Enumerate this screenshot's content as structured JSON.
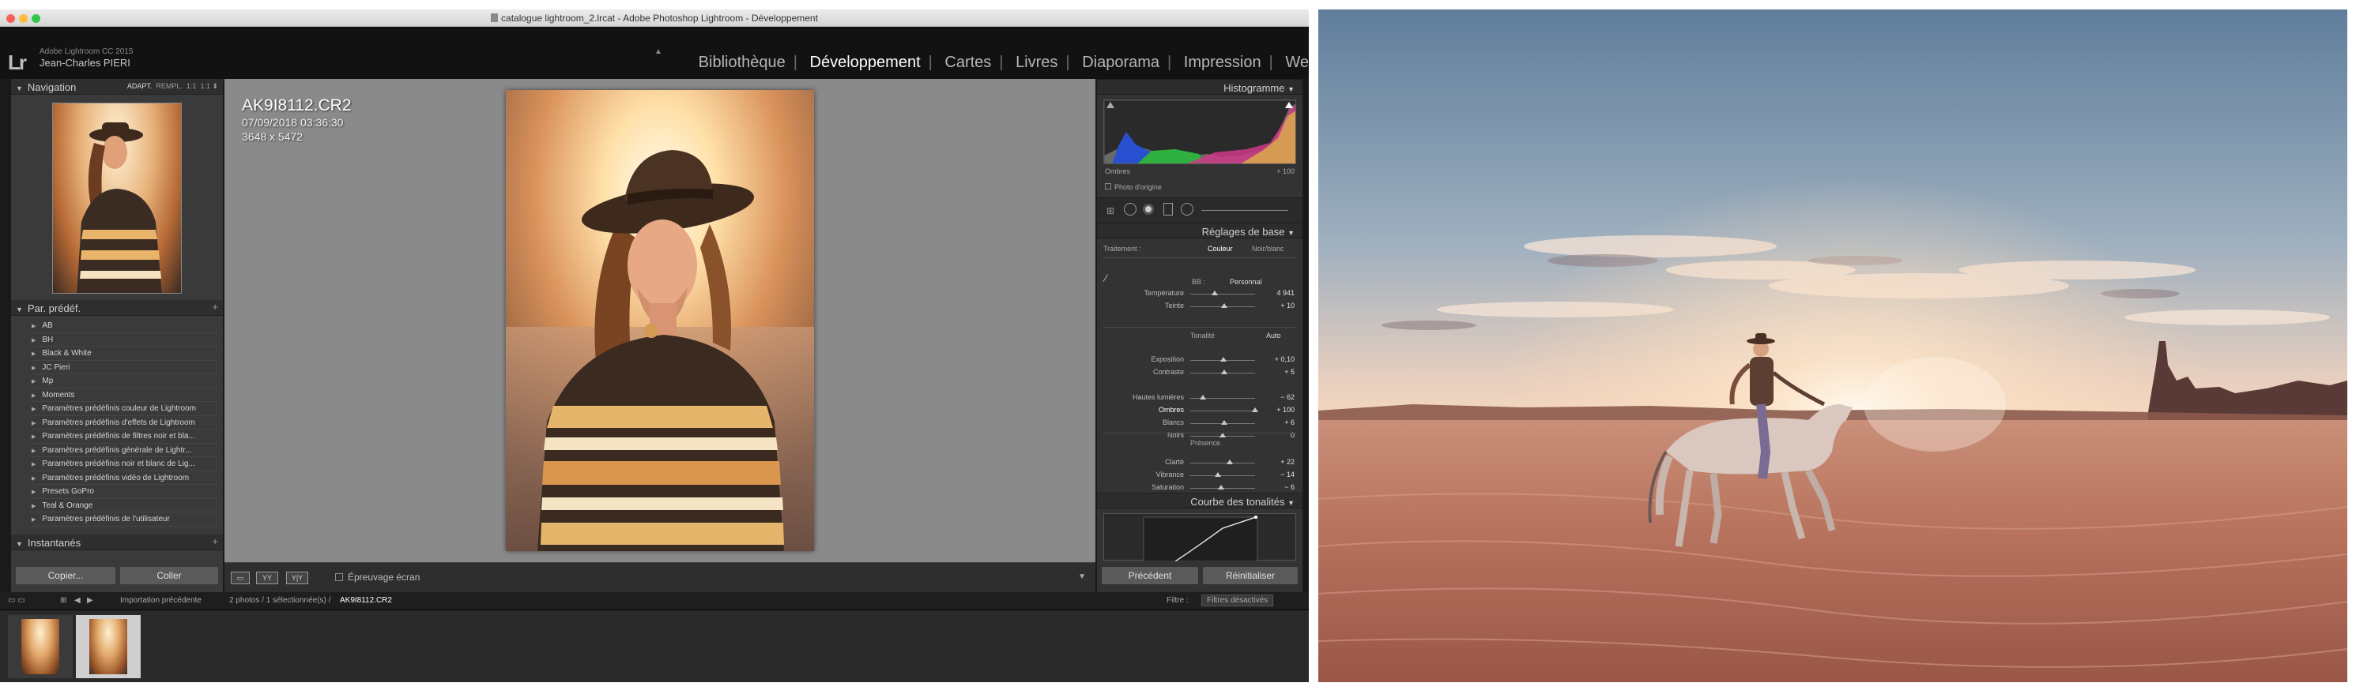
{
  "window": {
    "title": "catalogue lightroom_2.lrcat - Adobe Photoshop Lightroom - Développement"
  },
  "identity": {
    "line1": "Adobe Lightroom CC 2015",
    "line2": "Jean-Charles PIERI",
    "logo": "Lr"
  },
  "modules": [
    "Bibliothèque",
    "Développement",
    "Cartes",
    "Livres",
    "Diaporama",
    "Impression",
    "We"
  ],
  "active_module": "Développement",
  "navigator": {
    "title": "Navigation",
    "zoom_options": [
      "ADAPT.",
      "REMPL.",
      "1:1",
      "1:1"
    ]
  },
  "presets": {
    "title": "Par. prédéf.",
    "items": [
      "AB",
      "BH",
      "Black & White",
      "JC Pieri",
      "Mp",
      "Moments",
      "Paramètres prédéfinis couleur de Lightroom",
      "Paramètres prédéfinis d'effets de Lightroom",
      "Paramètres prédéfinis de filtres noir et bla...",
      "Paramètres prédéfinis générale de Lightr...",
      "Paramètres prédéfinis noir et blanc de Lig...",
      "Paramètres prédéfinis vidéo de Lightroom",
      "Presets GoPro",
      "Teal & Orange",
      "Paramètres prédéfinis de l'utilisateur"
    ]
  },
  "snapshots": {
    "title": "Instantanés"
  },
  "left_buttons": {
    "copy": "Copier...",
    "paste": "Coller"
  },
  "photo_info": {
    "filename": "AK9I8112.CR2",
    "datetime": "07/09/2018 03:36:30",
    "dimensions": "3648 x 5472"
  },
  "toolbar": {
    "soft_proof": "Épreuvage écran"
  },
  "histogram": {
    "title": "Histogramme",
    "shadow_label": "Ombres",
    "shadow_value": "+ 100",
    "original_photo": "Photo d'origine"
  },
  "basic": {
    "title": "Réglages de base",
    "treatment_label": "Traitement :",
    "treatment_color": "Couleur",
    "treatment_bw": "Noir/blanc",
    "wb_label": "BB :",
    "wb_value": "Personnal",
    "tone_label": "Tonalité",
    "tone_auto": "Auto",
    "presence_label": "Présence",
    "sliders": [
      {
        "label": "Température",
        "value": "4 941",
        "pos": 0.38
      },
      {
        "label": "Teinte",
        "value": "+ 10",
        "pos": 0.52
      },
      {
        "label": "Exposition",
        "value": "+ 0,10",
        "pos": 0.51
      },
      {
        "label": "Contraste",
        "value": "+ 5",
        "pos": 0.52
      },
      {
        "label": "Hautes lumières",
        "value": "− 62",
        "pos": 0.19
      },
      {
        "label": "Ombres",
        "value": "+ 100",
        "pos": 1.0
      },
      {
        "label": "Blancs",
        "value": "+ 6",
        "pos": 0.53
      },
      {
        "label": "Noirs",
        "value": "0",
        "pos": 0.5
      },
      {
        "label": "Clarté",
        "value": "+ 22",
        "pos": 0.61
      },
      {
        "label": "Vibrance",
        "value": "− 14",
        "pos": 0.43
      },
      {
        "label": "Saturation",
        "value": "− 6",
        "pos": 0.47
      }
    ]
  },
  "curve": {
    "title": "Courbe des tonalités"
  },
  "right_buttons": {
    "previous": "Précédent",
    "reset": "Réinitialiser"
  },
  "filmstrip": {
    "source": "Importation précédente",
    "count_text": "2 photos / 1 sélectionnée(s) /",
    "current": "AK9I8112.CR2",
    "filter_label": "Filtre :",
    "filter_value": "Filtres désactivés"
  },
  "colors": {
    "accent_active": "#ffffff",
    "panel_bg": "#333333",
    "center_bg": "#8a8a8a"
  }
}
